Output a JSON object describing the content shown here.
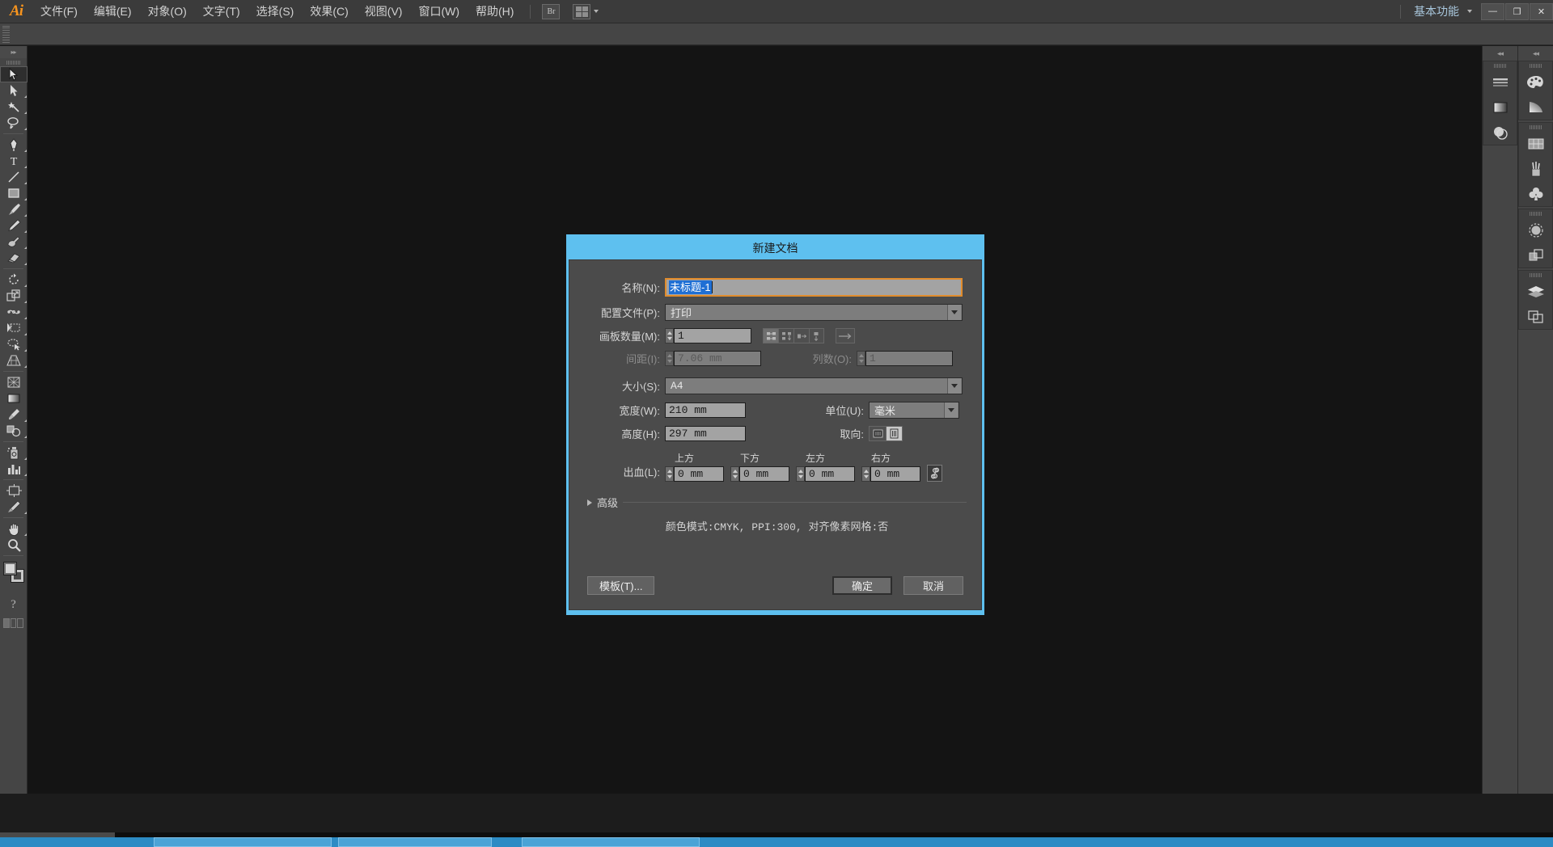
{
  "app": {
    "logo": "Ai",
    "workspace": "基本功能",
    "window_buttons": [
      {
        "name": "minimize",
        "glyph": "—"
      },
      {
        "name": "restore",
        "glyph": "❐"
      },
      {
        "name": "close",
        "glyph": "✕"
      }
    ],
    "bridge_button": "Br"
  },
  "menu": {
    "items": [
      "文件(F)",
      "编辑(E)",
      "对象(O)",
      "文字(T)",
      "选择(S)",
      "效果(C)",
      "视图(V)",
      "窗口(W)",
      "帮助(H)"
    ]
  },
  "toolbar": {
    "tools": [
      {
        "name": "selection-tool",
        "active": true
      },
      {
        "name": "direct-selection-tool",
        "active": false
      },
      {
        "name": "magic-wand-tool",
        "active": false
      },
      {
        "name": "lasso-tool",
        "active": false
      },
      {
        "name": "pen-tool",
        "active": false
      },
      {
        "name": "type-tool",
        "active": false
      },
      {
        "name": "line-segment-tool",
        "active": false
      },
      {
        "name": "rectangle-tool",
        "active": false
      },
      {
        "name": "paintbrush-tool",
        "active": false
      },
      {
        "name": "pencil-tool",
        "active": false
      },
      {
        "name": "blob-brush-tool",
        "active": false
      },
      {
        "name": "eraser-tool",
        "active": false
      },
      {
        "name": "rotate-tool",
        "active": false
      },
      {
        "name": "scale-tool",
        "active": false
      },
      {
        "name": "width-tool",
        "active": false
      },
      {
        "name": "free-transform-tool",
        "active": false
      },
      {
        "name": "shape-builder-tool",
        "active": false
      },
      {
        "name": "perspective-grid-tool",
        "active": false
      },
      {
        "name": "mesh-tool",
        "active": false
      },
      {
        "name": "gradient-tool",
        "active": false
      },
      {
        "name": "eyedropper-tool",
        "active": false
      },
      {
        "name": "blend-tool",
        "active": false
      },
      {
        "name": "symbol-sprayer-tool",
        "active": false
      },
      {
        "name": "column-graph-tool",
        "active": false
      },
      {
        "name": "artboard-tool",
        "active": false
      },
      {
        "name": "slice-tool",
        "active": false
      },
      {
        "name": "hand-tool",
        "active": false
      },
      {
        "name": "zoom-tool",
        "active": false
      }
    ]
  },
  "dialog": {
    "title": "新建文档",
    "name": {
      "label": "名称(N):",
      "value": "未标题-1",
      "selected": true
    },
    "profile": {
      "label": "配置文件(P):",
      "value": "打印"
    },
    "artboards": {
      "label": "画板数量(M):",
      "value": "1",
      "layout_buttons": [
        {
          "name": "grid-by-row",
          "selected": true
        },
        {
          "name": "grid-by-column",
          "selected": false
        },
        {
          "name": "arrange-by-row",
          "selected": false
        },
        {
          "name": "arrange-by-column",
          "selected": false
        }
      ],
      "direction_button": {
        "name": "right-to-left",
        "selected": false
      }
    },
    "spacing": {
      "label": "间距(I):",
      "value": "7.06 mm",
      "disabled": true
    },
    "columns": {
      "label": "列数(O):",
      "value": "1",
      "disabled": true
    },
    "size": {
      "label": "大小(S):",
      "value": "A4"
    },
    "width": {
      "label": "宽度(W):",
      "value": "210 mm"
    },
    "height": {
      "label": "高度(H):",
      "value": "297 mm"
    },
    "units": {
      "label": "单位(U):",
      "value": "毫米"
    },
    "orientation": {
      "label": "取向:",
      "options": [
        {
          "name": "landscape",
          "selected": false
        },
        {
          "name": "portrait",
          "selected": true
        }
      ]
    },
    "bleed": {
      "label": "出血(L):",
      "fields": [
        {
          "caption": "上方",
          "value": "0 mm"
        },
        {
          "caption": "下方",
          "value": "0 mm"
        },
        {
          "caption": "左方",
          "value": "0 mm"
        },
        {
          "caption": "右方",
          "value": "0 mm"
        }
      ],
      "link_button": "link-bleed"
    },
    "advanced": {
      "label": "高级",
      "expanded": false,
      "summary": "颜色模式:CMYK, PPI:300,  对齐像素网格:否"
    },
    "buttons": {
      "template": "模板(T)...",
      "ok": "确定",
      "cancel": "取消"
    }
  },
  "docks": {
    "left_column": [
      {
        "name": "stroke-panel"
      },
      {
        "name": "gradient-panel"
      },
      {
        "name": "transparency-panel"
      }
    ],
    "right_column_group1": [
      {
        "name": "color-panel"
      },
      {
        "name": "color-guide-panel"
      }
    ],
    "right_column_group2": [
      {
        "name": "swatches-panel"
      },
      {
        "name": "brushes-panel"
      },
      {
        "name": "symbols-panel"
      }
    ],
    "right_column_group3": [
      {
        "name": "appearance-panel"
      },
      {
        "name": "graphic-styles-panel"
      }
    ],
    "right_column_group4": [
      {
        "name": "layers-panel"
      },
      {
        "name": "artboards-panel"
      }
    ]
  },
  "colors": {
    "dialog_border": "#5ec0ef",
    "dialog_bg": "#4b4b4b",
    "field_bg": "#a3a3a3",
    "focus_outline": "#e08c2d",
    "selection_blue": "#1f6fd4",
    "ui_chrome": "#454545",
    "canvas": "#141414",
    "accent_logo": "#f7941e",
    "taskbar": "#2c8bc4"
  }
}
